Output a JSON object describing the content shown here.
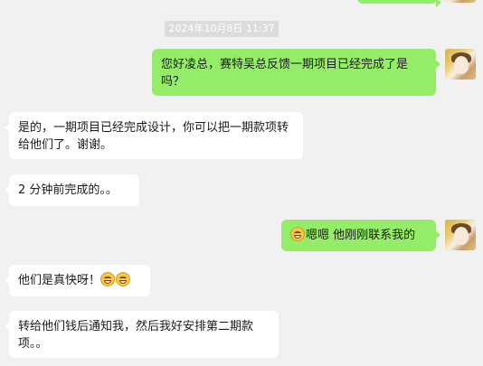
{
  "chat": {
    "timestamp": "2024年10月8日 11:37",
    "messages": [
      {
        "side": "out",
        "text": "您好凌总，赛特吴总反馈一期项目已经完成了是吗？"
      },
      {
        "side": "in",
        "text": "是的，一期项目已经完成设计，你可以把一期款项转给他们了。谢谢。"
      },
      {
        "side": "in",
        "text": "2 分钟前完成的。。"
      },
      {
        "side": "out",
        "text": "嗯嗯 他刚刚联系我的",
        "emoji_prefix": "grin-emoji"
      },
      {
        "side": "in",
        "text": "他们是真快呀！",
        "emoji_suffix": [
          "grin-emoji",
          "grin-emoji"
        ]
      },
      {
        "side": "in",
        "text": "转给他们钱后通知我，然后我好安排第二期款项。。"
      }
    ]
  }
}
